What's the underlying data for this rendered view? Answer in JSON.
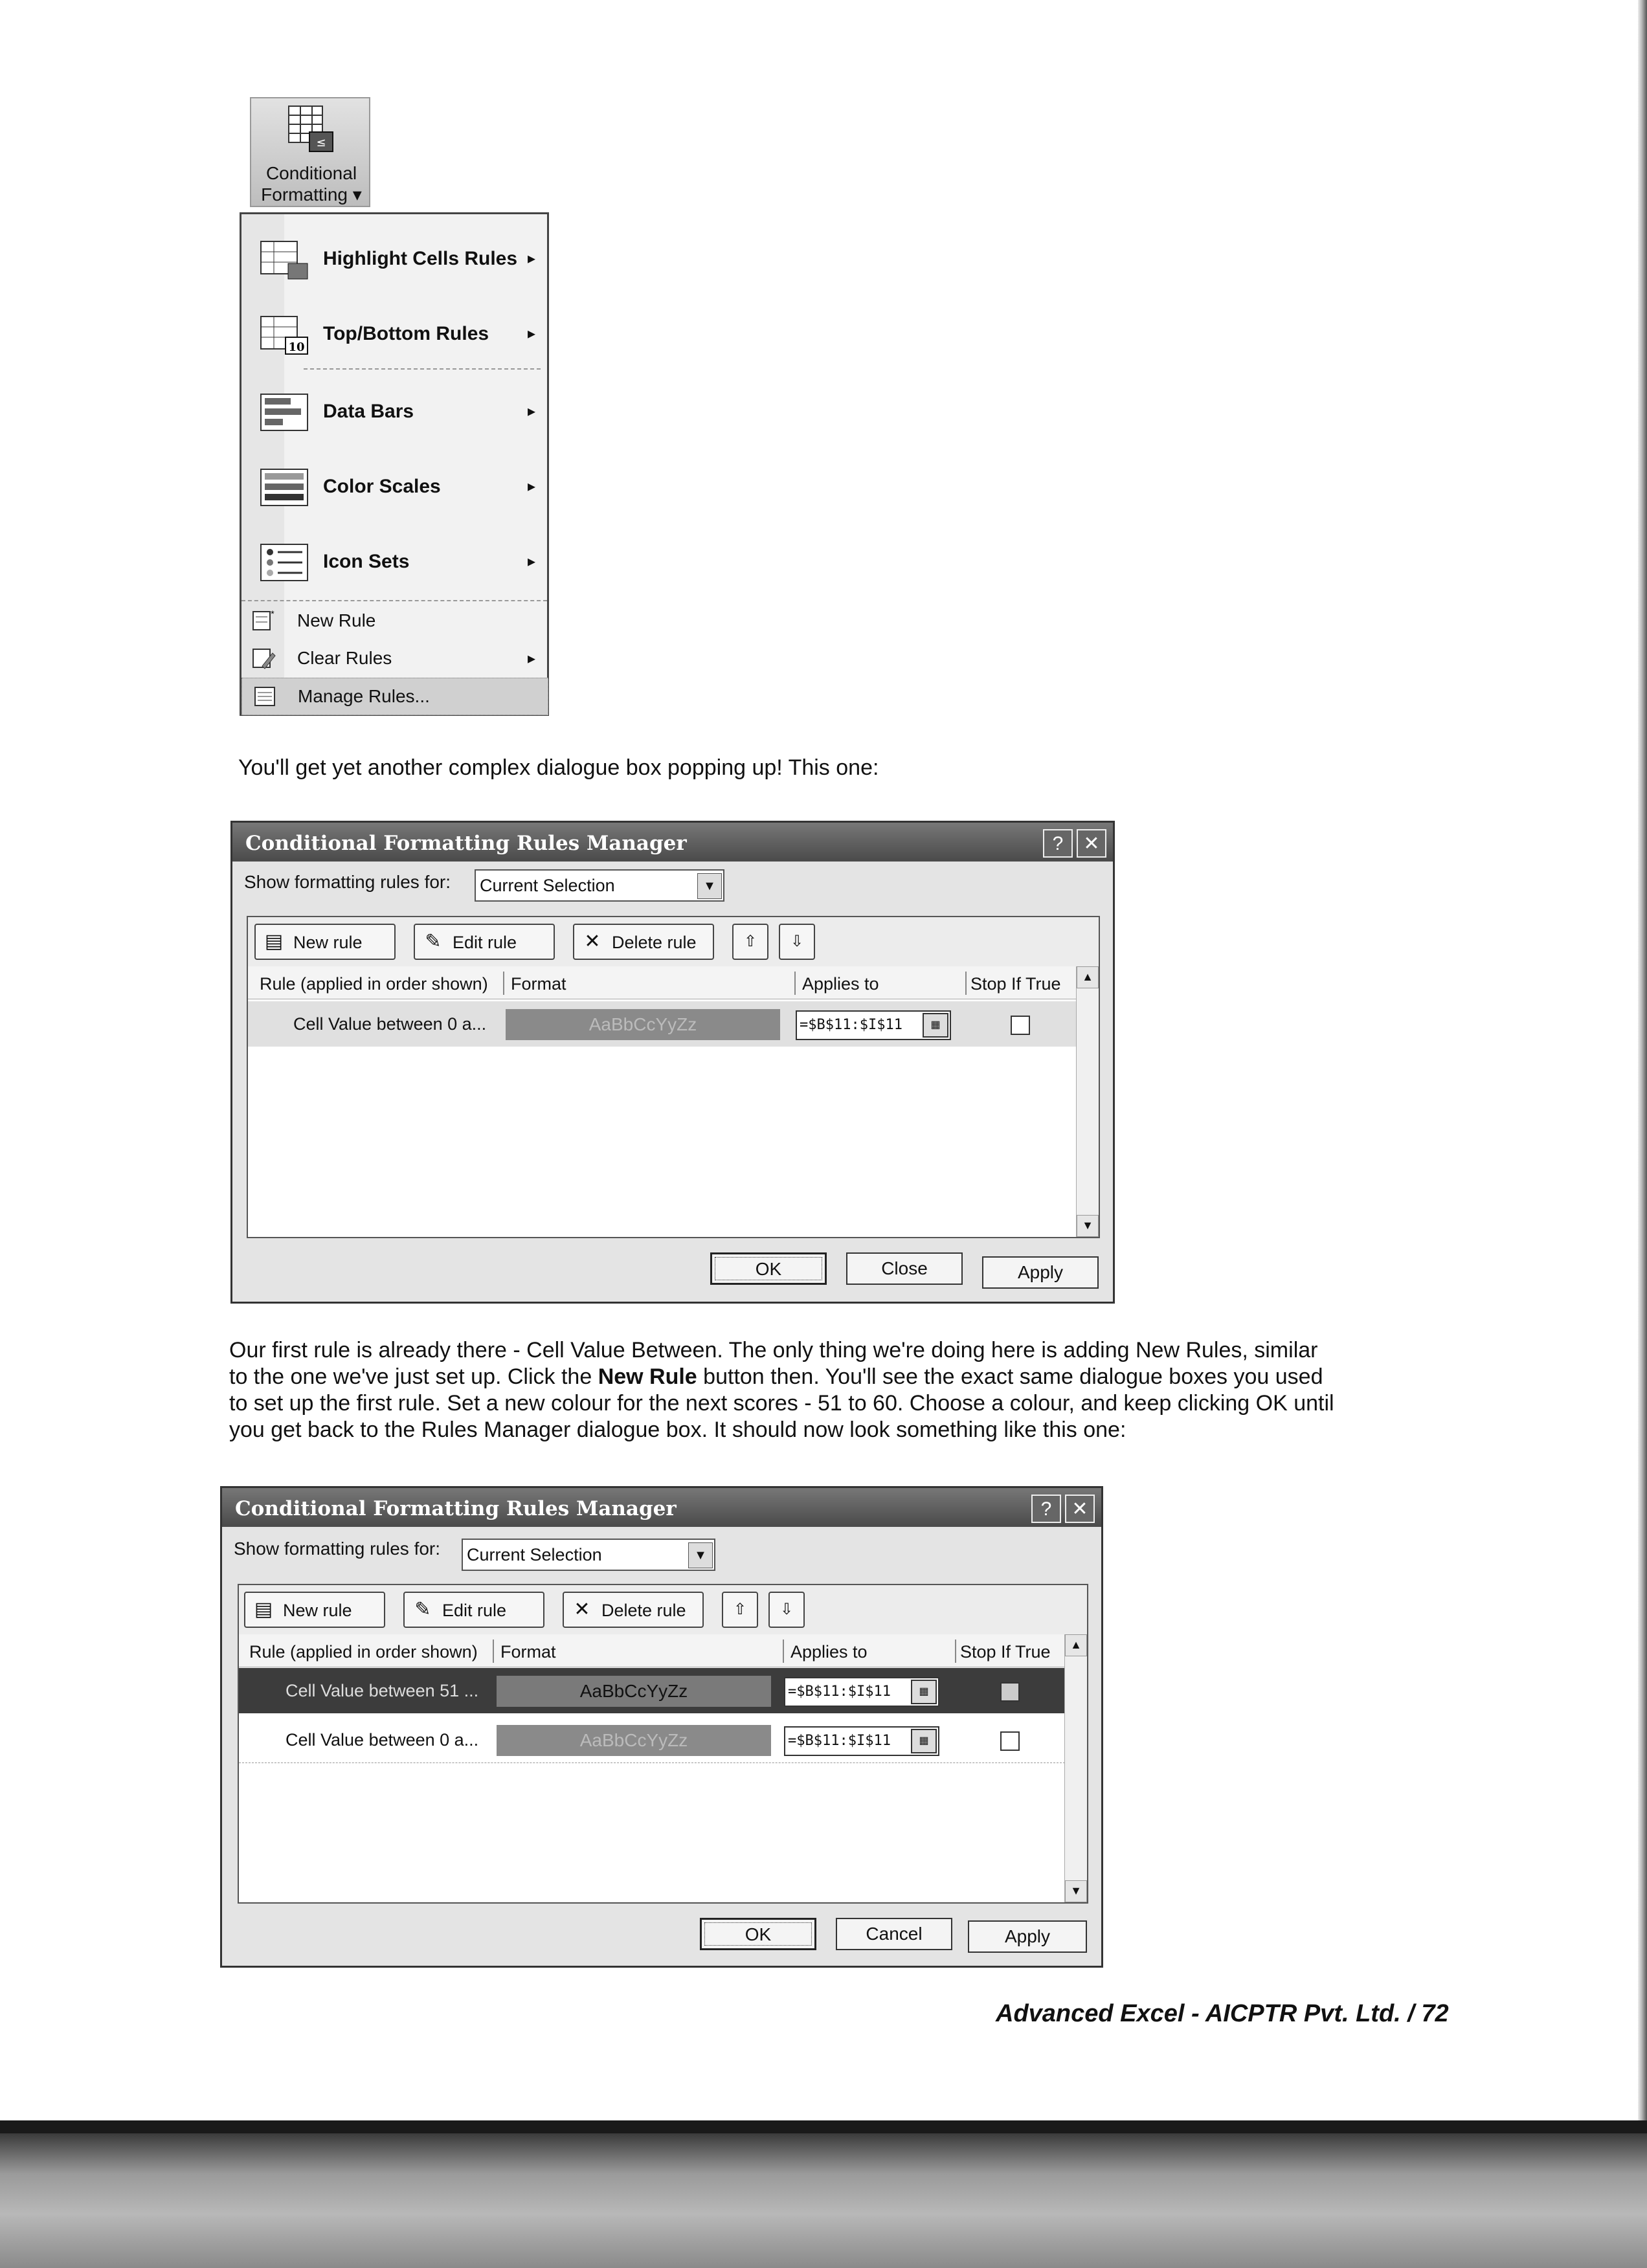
{
  "ribbon_button": {
    "label_line1": "Conditional",
    "label_line2": "Formatting ▾",
    "icon": "conditional-formatting-icon"
  },
  "cf_menu": {
    "main_items": [
      {
        "label": "Highlight Cells Rules",
        "arrow": "▸",
        "icon": "highlight-cells-icon"
      },
      {
        "label": "Top/Bottom Rules",
        "arrow": "▸",
        "icon": "top-bottom-icon"
      },
      {
        "label": "Data Bars",
        "arrow": "▸",
        "icon": "data-bars-icon"
      },
      {
        "label": "Color Scales",
        "arrow": "▸",
        "icon": "color-scales-icon"
      },
      {
        "label": "Icon Sets",
        "arrow": "▸",
        "icon": "icon-sets-icon"
      }
    ],
    "small_items": [
      {
        "label": "New Rule",
        "arrow": "",
        "icon": "new-rule-icon"
      },
      {
        "label": "Clear Rules",
        "arrow": "▸",
        "icon": "clear-rules-icon"
      },
      {
        "label": "Manage Rules...",
        "arrow": "",
        "icon": "manage-rules-icon"
      }
    ]
  },
  "text": {
    "para1": "You'll get yet another complex dialogue box popping up! This one:",
    "para2_line1": "Our first rule is already there - Cell Value Between. The only thing we're doing here is adding New Rules, similar",
    "para2_line2_a": "to the one we've just set up. Click the ",
    "para2_line2_b": "New Rule",
    "para2_line2_c": " button then. You'll see the exact same dialogue boxes you used",
    "para2_line3": "to set up the first rule. Set a new colour for the next scores - 51 to 60. Choose a colour, and keep clicking OK until",
    "para2_line4": "you get back to the Rules Manager dialogue box. It should now look something like this one:",
    "footer": "Advanced Excel - AICPTR Pvt. Ltd.  / 72"
  },
  "dialog1": {
    "title": "Conditional Formatting Rules Manager",
    "help": "?",
    "close_x": "✕",
    "show_label": "Show formatting rules for:",
    "show_value": "Current Selection",
    "new_rule": "New rule",
    "edit_rule": "Edit rule",
    "delete_rule": "Delete rule",
    "move_up": "⇧",
    "move_down": "⇩",
    "col_rule": "Rule (applied in order shown)",
    "col_format": "Format",
    "col_applies": "Applies to",
    "col_stop": "Stop If True",
    "rows": [
      {
        "rule": "Cell Value between 0 a...",
        "format_preview": "AaBbCcYyZz",
        "applies": "=$B$11:$I$11",
        "stop": false
      }
    ],
    "ok": "OK",
    "close": "Close",
    "apply": "Apply"
  },
  "dialog2": {
    "title": "Conditional Formatting Rules Manager",
    "help": "?",
    "close_x": "✕",
    "show_label": "Show formatting rules for:",
    "show_value": "Current Selection",
    "new_rule": "New rule",
    "edit_rule": "Edit rule",
    "delete_rule": "Delete rule",
    "move_up": "⇧",
    "move_down": "⇩",
    "col_rule": "Rule (applied in order shown)",
    "col_format": "Format",
    "col_applies": "Applies to",
    "col_stop": "Stop If True",
    "rows": [
      {
        "rule": "Cell Value between 51 ...",
        "format_preview": "AaBbCcYyZz",
        "applies": "=$B$11:$I$11",
        "stop": false
      },
      {
        "rule": "Cell Value between 0 a...",
        "format_preview": "AaBbCcYyZz",
        "applies": "=$B$11:$I$11",
        "stop": false
      }
    ],
    "ok": "OK",
    "cancel": "Cancel",
    "apply": "Apply"
  },
  "colors": {
    "title_bar": "#555555",
    "format_swatch": "#8a8a8a",
    "selected_row": "#3c3c3c"
  }
}
